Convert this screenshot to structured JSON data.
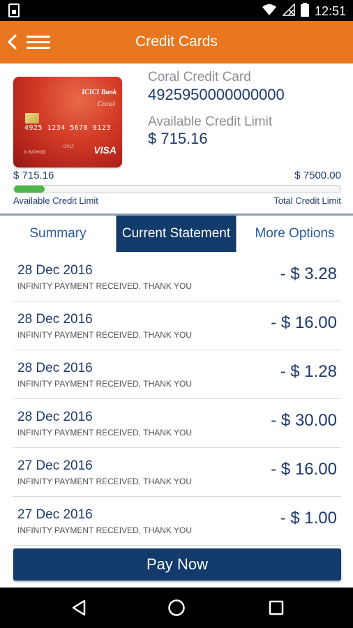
{
  "status_bar": {
    "time": "12:51",
    "icons": [
      "sim-card-icon",
      "wifi-icon",
      "no-signal-icon",
      "battery-icon"
    ]
  },
  "app_bar": {
    "title": "Credit Cards",
    "back_icon": "chevron-left-icon",
    "menu_icon": "hamburger-menu-icon",
    "background_color": "#e8771f"
  },
  "card": {
    "image": {
      "bank": "ICICI Bank",
      "brand": "Coral",
      "number": "4925 1234 5678 9123",
      "expiry": "07/17",
      "holder": "K RATHOD",
      "network": "VISA"
    },
    "name": "Coral Credit Card",
    "number": "4925950000000000",
    "available_label": "Available Credit Limit",
    "available_value": "$ 715.16"
  },
  "limits": {
    "available_amount": "$ 715.16",
    "total_amount": "$ 7500.00",
    "available_caption": "Available Credit Limit",
    "total_caption": "Total Credit Limit",
    "available_fraction": 0.095,
    "fill_color": "#4db84a"
  },
  "tabs": [
    {
      "label": "Summary",
      "active": false
    },
    {
      "label": "Current Statement",
      "active": true
    },
    {
      "label": "More Options",
      "active": false
    }
  ],
  "transactions": [
    {
      "date": "28 Dec 2016",
      "description": "INFINITY PAYMENT RECEIVED, THANK YOU",
      "amount": "- $ 3.28"
    },
    {
      "date": "28 Dec 2016",
      "description": "INFINITY PAYMENT RECEIVED, THANK YOU",
      "amount": "- $ 16.00"
    },
    {
      "date": "28 Dec 2016",
      "description": "INFINITY PAYMENT RECEIVED, THANK YOU",
      "amount": "- $ 1.28"
    },
    {
      "date": "28 Dec 2016",
      "description": "INFINITY PAYMENT RECEIVED, THANK YOU",
      "amount": "- $ 30.00"
    },
    {
      "date": "27 Dec 2016",
      "description": "INFINITY PAYMENT RECEIVED, THANK YOU",
      "amount": "- $ 16.00"
    },
    {
      "date": "27 Dec 2016",
      "description": "INFINITY PAYMENT RECEIVED, THANK YOU",
      "amount": "- $ 1.00"
    }
  ],
  "pay_button": {
    "label": "Pay Now",
    "color": "#123a6b"
  },
  "nav_bar": {
    "icons": [
      "back-triangle-icon",
      "home-circle-icon",
      "recents-square-icon"
    ]
  }
}
